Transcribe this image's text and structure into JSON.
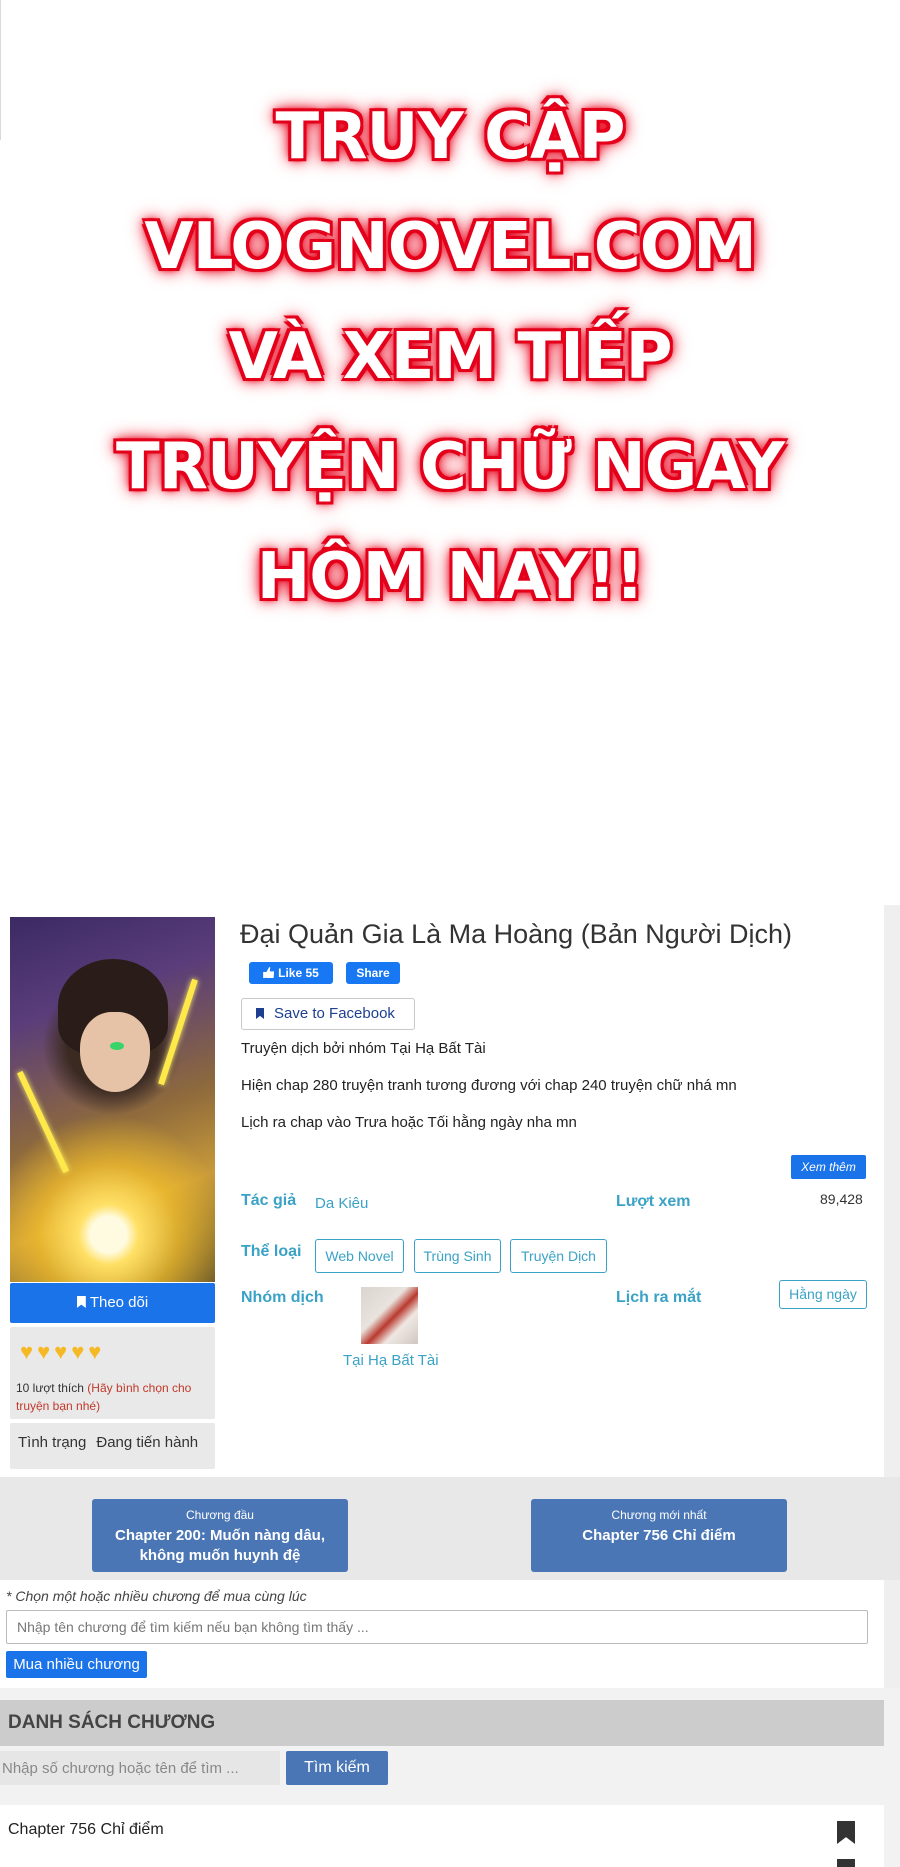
{
  "banner": {
    "lines": [
      "TRUY CẬP",
      "VLOGNOVEL.COM",
      "VÀ XEM TIẾP",
      "TRUYỆN CHỮ NGAY",
      "HÔM NAY!!"
    ]
  },
  "manga": {
    "title": "Đại Quản Gia Là Ma Hoàng (Bản Người Dịch)",
    "fb_like": "Like 55",
    "fb_share": "Share",
    "save_facebook": "Save to Facebook",
    "description": [
      "Truyện dịch bởi nhóm Tại Hạ Bất Tài",
      "Hiện chap 280 truyện tranh tương đương với chap 240 truyện chữ nhá mn",
      "Lịch ra chap vào Trưa hoặc Tối hằng ngày nha mn"
    ],
    "see_more": "Xem thêm",
    "author_label": "Tác giả",
    "author": "Da Kiêu",
    "views_label": "Lượt xem",
    "views": "89,428",
    "genre_label": "Thể loại",
    "genres": [
      "Web Novel",
      "Trùng Sinh",
      "Truyện Dịch"
    ],
    "group_label": "Nhóm dịch",
    "group_name": "Tại Hạ Bất Tài",
    "schedule_label": "Lịch ra mắt",
    "schedule": "Hằng ngày",
    "follow": "Theo dõi",
    "hearts": "♥♥♥♥♥",
    "likes_text": "10 lượt thích",
    "likes_hint": "(Hãy bình chọn cho truyện bạn nhé)",
    "status_label": "Tình trạng",
    "status_value": "Đang tiến hành"
  },
  "chapters_nav": {
    "first_label": "Chương đầu",
    "first_title": "Chapter 200: Muốn nàng dâu, không muốn huynh đệ",
    "latest_label": "Chương mới nhất",
    "latest_title": "Chapter 756 Chỉ điểm"
  },
  "multi_buy": {
    "note": "* Chọn một hoặc nhiều chương để mua cùng lúc",
    "placeholder": "Nhập tên chương để tìm kiếm nếu bạn không tìm thấy ...",
    "button": "Mua nhiều chương"
  },
  "chapter_list": {
    "heading": "DANH SÁCH CHƯƠNG",
    "search_placeholder": "Nhập số chương hoặc tên để tìm ...",
    "search_button": "Tìm kiếm",
    "rows": [
      {
        "title": "Chapter 756 Chỉ điểm"
      }
    ]
  }
}
